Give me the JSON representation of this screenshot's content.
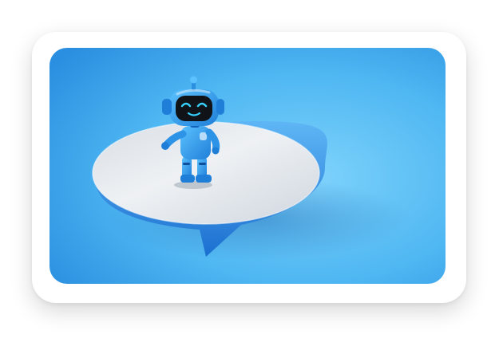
{
  "image": {
    "subject": "robot-on-speech-bubble",
    "colors": {
      "background": "#ffffff",
      "sky_light": "#7fd3fb",
      "sky_mid": "#4fb7f2",
      "sky_dark": "#2a8fe0",
      "bubble_top": "#e9edf1",
      "bubble_rim": "#2f8fe6",
      "robot_body": "#3aa6ee",
      "robot_dark": "#1469c4",
      "visor": "#101418",
      "face_glow": "#36d1ff"
    },
    "icons": [
      "robot-figure",
      "speech-bubble-platform"
    ]
  }
}
